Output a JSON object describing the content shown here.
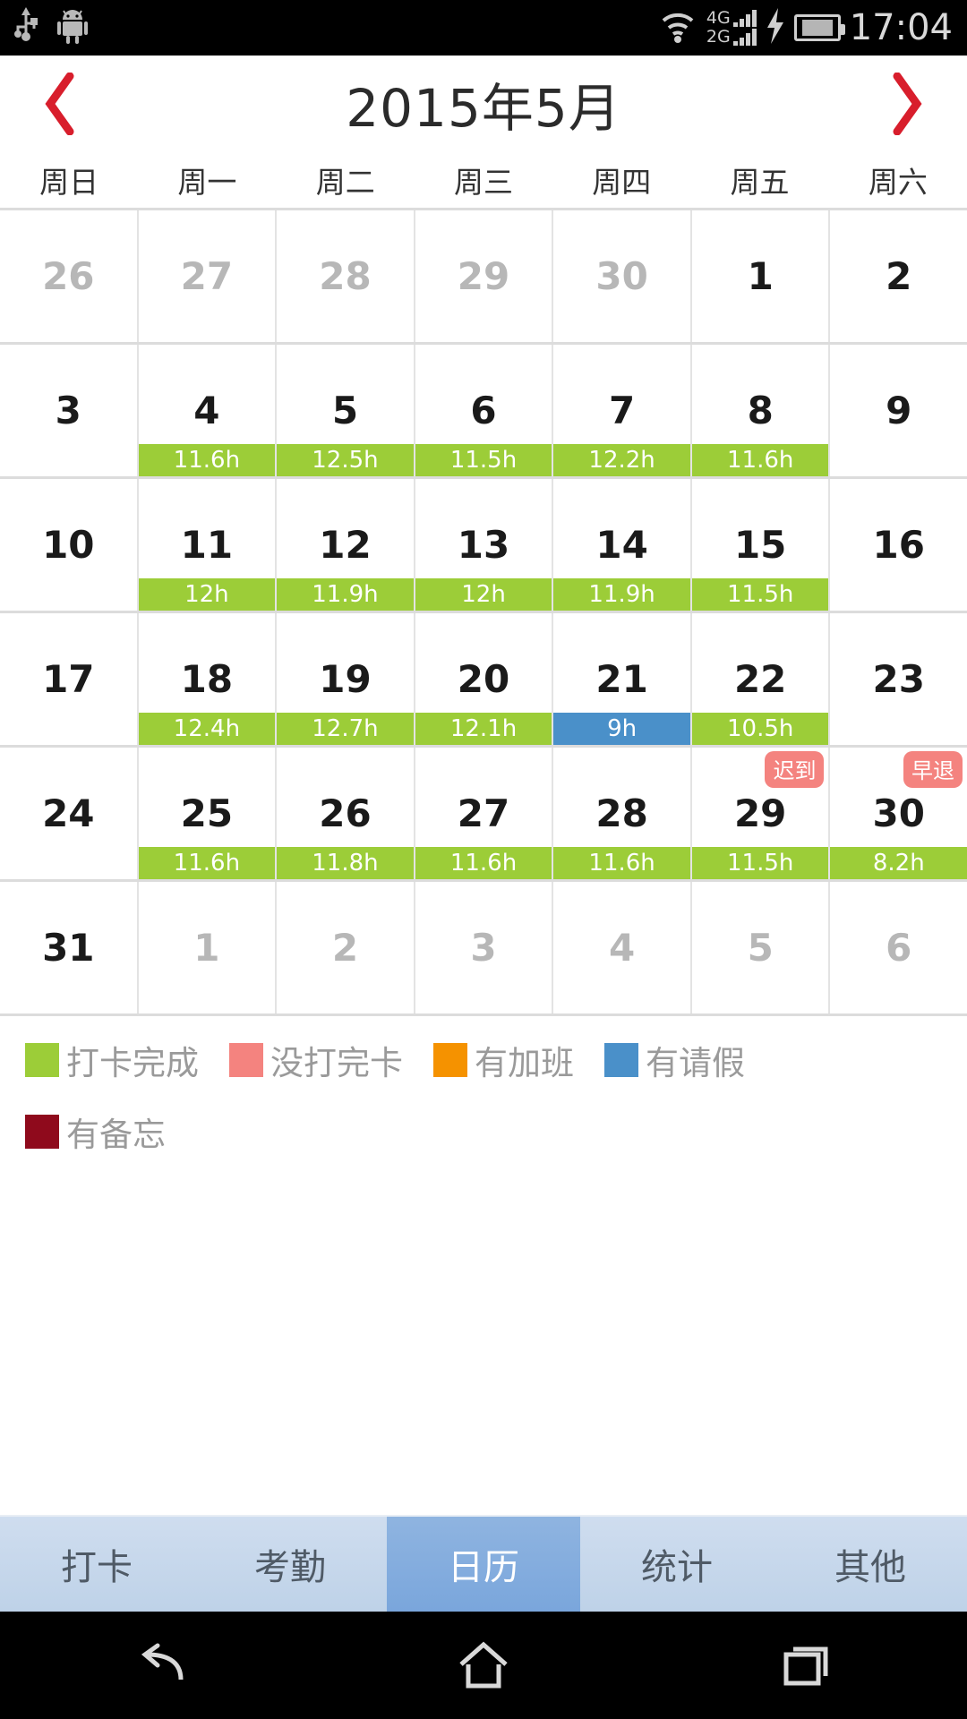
{
  "statusbar": {
    "icons": [
      "usb-icon",
      "android-robot-icon",
      "wifi-icon",
      "charging-bolt-icon",
      "battery-icon"
    ],
    "network_primary": "4G",
    "network_secondary": "2G",
    "clock": "17:04"
  },
  "header": {
    "prev_label": "‹",
    "next_label": "›",
    "title": "2015年5月",
    "accent_color": "#d81e2c"
  },
  "weekdays": [
    "周日",
    "周一",
    "周二",
    "周三",
    "周四",
    "周五",
    "周六"
  ],
  "colors": {
    "complete": "#9ccd38",
    "incomplete": "#f4837f",
    "overtime": "#f59200",
    "leave": "#4a90c9",
    "memo": "#8f0a1c",
    "out_of_month_text": "#b7b7b7",
    "tab_active": "#7aa6dc"
  },
  "calendar": {
    "weeks": [
      [
        {
          "day": "26",
          "out": true
        },
        {
          "day": "27",
          "out": true
        },
        {
          "day": "28",
          "out": true
        },
        {
          "day": "29",
          "out": true
        },
        {
          "day": "30",
          "out": true
        },
        {
          "day": "1",
          "out": false
        },
        {
          "day": "2",
          "out": false
        }
      ],
      [
        {
          "day": "3",
          "out": false
        },
        {
          "day": "4",
          "out": false,
          "hours": "11.6h",
          "status": "complete"
        },
        {
          "day": "5",
          "out": false,
          "hours": "12.5h",
          "status": "complete"
        },
        {
          "day": "6",
          "out": false,
          "hours": "11.5h",
          "status": "complete"
        },
        {
          "day": "7",
          "out": false,
          "hours": "12.2h",
          "status": "complete"
        },
        {
          "day": "8",
          "out": false,
          "hours": "11.6h",
          "status": "complete"
        },
        {
          "day": "9",
          "out": false
        }
      ],
      [
        {
          "day": "10",
          "out": false
        },
        {
          "day": "11",
          "out": false,
          "hours": "12h",
          "status": "complete"
        },
        {
          "day": "12",
          "out": false,
          "hours": "11.9h",
          "status": "complete"
        },
        {
          "day": "13",
          "out": false,
          "hours": "12h",
          "status": "complete"
        },
        {
          "day": "14",
          "out": false,
          "hours": "11.9h",
          "status": "complete"
        },
        {
          "day": "15",
          "out": false,
          "hours": "11.5h",
          "status": "complete"
        },
        {
          "day": "16",
          "out": false
        }
      ],
      [
        {
          "day": "17",
          "out": false
        },
        {
          "day": "18",
          "out": false,
          "hours": "12.4h",
          "status": "complete"
        },
        {
          "day": "19",
          "out": false,
          "hours": "12.7h",
          "status": "complete"
        },
        {
          "day": "20",
          "out": false,
          "hours": "12.1h",
          "status": "complete"
        },
        {
          "day": "21",
          "out": false,
          "hours": "9h",
          "status": "leave"
        },
        {
          "day": "22",
          "out": false,
          "hours": "10.5h",
          "status": "complete"
        },
        {
          "day": "23",
          "out": false
        }
      ],
      [
        {
          "day": "24",
          "out": false
        },
        {
          "day": "25",
          "out": false,
          "hours": "11.6h",
          "status": "complete"
        },
        {
          "day": "26",
          "out": false,
          "hours": "11.8h",
          "status": "complete"
        },
        {
          "day": "27",
          "out": false,
          "hours": "11.6h",
          "status": "complete"
        },
        {
          "day": "28",
          "out": false,
          "hours": "11.6h",
          "status": "complete"
        },
        {
          "day": "29",
          "out": false,
          "hours": "11.5h",
          "status": "complete",
          "badge": "迟到"
        },
        {
          "day": "30",
          "out": false,
          "hours": "8.2h",
          "status": "complete",
          "badge": "早退"
        }
      ],
      [
        {
          "day": "31",
          "out": false
        },
        {
          "day": "1",
          "out": true
        },
        {
          "day": "2",
          "out": true
        },
        {
          "day": "3",
          "out": true
        },
        {
          "day": "4",
          "out": true
        },
        {
          "day": "5",
          "out": true
        },
        {
          "day": "6",
          "out": true
        }
      ]
    ]
  },
  "legend": [
    [
      {
        "label": "打卡完成",
        "color": "#9ccd38"
      },
      {
        "label": "没打完卡",
        "color": "#f4837f"
      },
      {
        "label": "有加班",
        "color": "#f59200"
      },
      {
        "label": "有请假",
        "color": "#4a90c9"
      }
    ],
    [
      {
        "label": "有备忘",
        "color": "#8f0a1c"
      }
    ]
  ],
  "tabs": [
    {
      "label": "打卡",
      "active": false
    },
    {
      "label": "考勤",
      "active": false
    },
    {
      "label": "日历",
      "active": true
    },
    {
      "label": "统计",
      "active": false
    },
    {
      "label": "其他",
      "active": false
    }
  ],
  "navbar": {
    "back": "back-icon",
    "home": "home-icon",
    "recents": "recents-icon"
  }
}
